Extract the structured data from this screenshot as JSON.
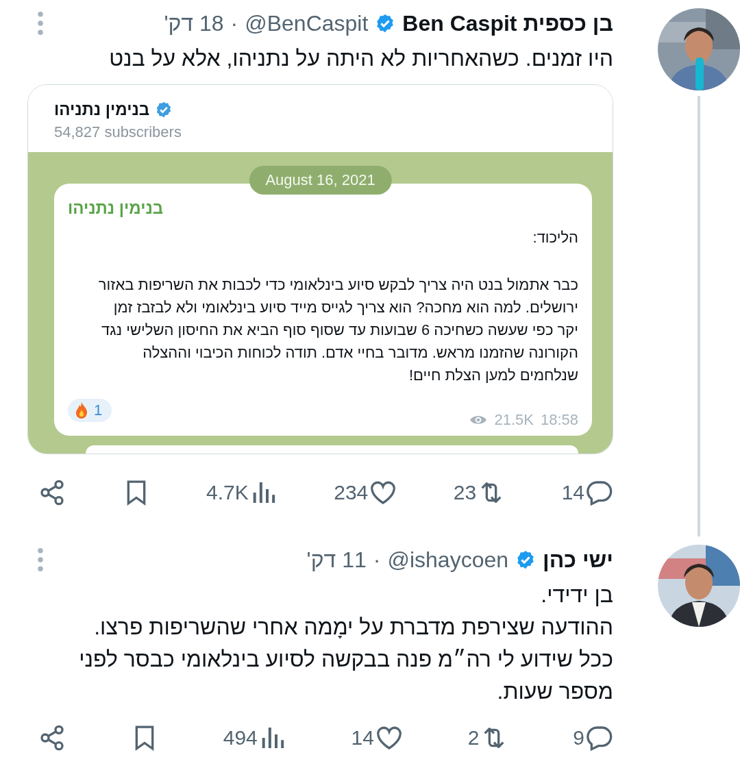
{
  "tweets": [
    {
      "author": {
        "name": "בן כספית Ben Caspit",
        "verified": true,
        "handle": "@BenCaspit",
        "separator": "·",
        "time": "18 דק'"
      },
      "text": "היו זמנים. כשהאחריות לא היתה על נתניהו, אלא על בנט",
      "embed": {
        "channel": "בנימין נתניהו",
        "channel_verified": true,
        "subscribers": "54,827 subscribers",
        "date": "August 16, 2021",
        "author": "בנימין נתניהו",
        "paragraphs": [
          "הליכוד:",
          "כבר אתמול בנט היה צריך לבקש סיוע בינלאומי כדי לכבות את השריפות באזור ירושלים. למה הוא מחכה? הוא צריך לגייס מייד סיוע בינלאומי ולא לבזבז זמן יקר כפי שעשה כשחיכה 6 שבועות עד שסוף סוף הביא את החיסון השלישי נגד הקורונה שהזמנו מראש. מדובר בחיי אדם. תודה לכוחות הכיבוי וההצלה שנלחמים למען הצלת חיים!"
        ],
        "reaction_count": "1",
        "views": "21.5K",
        "time": "18:58"
      },
      "actions": {
        "replies": "14",
        "retweets": "23",
        "likes": "234",
        "views": "4.7K"
      }
    },
    {
      "author": {
        "name": "ישי כהן",
        "verified": true,
        "handle": "@ishaycoen",
        "separator": "·",
        "time": "11 דק'"
      },
      "text": "בן ידידי.\nההודעה שצירפת מדברת על ימָמה אחרי שהשריפות פרצו. ככל שידוע לי רה״מ פנה בבקשה לסיוע בינלאומי כבסר לפני מספר שעות.",
      "actions": {
        "replies": "9",
        "retweets": "2",
        "likes": "14",
        "views": "494"
      }
    }
  ]
}
